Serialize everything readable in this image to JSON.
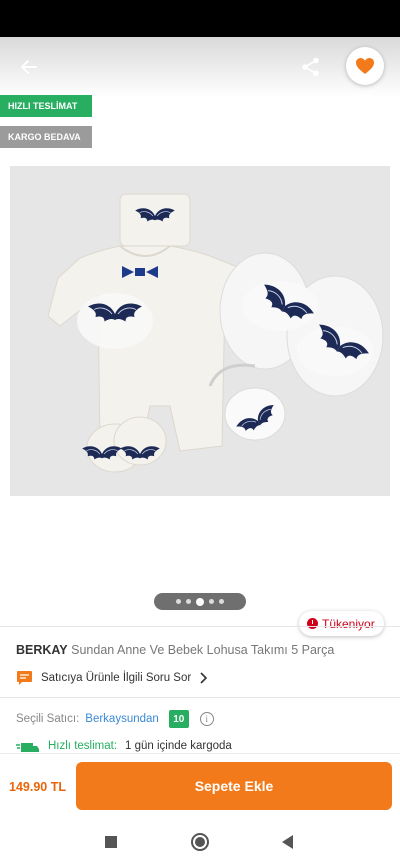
{
  "badges": {
    "fast_delivery": "HIZLI TESLİMAT",
    "free_cargo": "KARGO BEDAVA"
  },
  "gallery": {
    "pages": 5,
    "active_page": 3
  },
  "stock_status": "Tükeniyor",
  "product": {
    "brand": "BERKAY",
    "name": "Sundan Anne Ve Bebek Lohusa Takımı 5 Parça"
  },
  "question_link": "Satıcıya Ürünle İlgili Soru Sor",
  "seller": {
    "label": "Seçili Satıcı:",
    "name": "Berkaysundan",
    "score": "10"
  },
  "shipping": {
    "label": "Hızlı teslimat:",
    "text": "1 gün içinde kargoda"
  },
  "purchase": {
    "price": "149.90 TL",
    "add_to_cart": "Sepete Ekle"
  },
  "colors": {
    "accent": "#f27a1a",
    "green": "#27ae60",
    "stock_red": "#d0021b",
    "link_blue": "#3a8ad6"
  },
  "icons": [
    "back-arrow-icon",
    "share-icon",
    "heart-icon",
    "clock-icon",
    "chat-icon",
    "chevron-right-icon",
    "info-icon",
    "truck-icon"
  ]
}
